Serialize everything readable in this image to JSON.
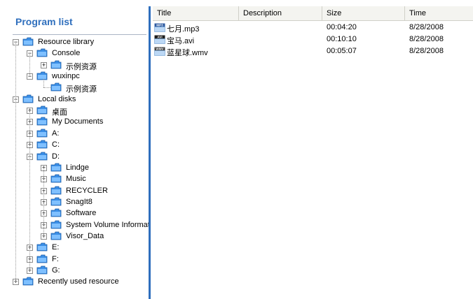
{
  "program_list": {
    "title": "Program list"
  },
  "tree": [
    {
      "id": "n0",
      "label": "Resource library",
      "level": 0,
      "toggle": "minus"
    },
    {
      "id": "n1",
      "label": "Console",
      "level": 1,
      "toggle": "minus"
    },
    {
      "id": "n2",
      "label": "示例资源",
      "level": 2,
      "toggle": "plus"
    },
    {
      "id": "n3",
      "label": "wuxinpc",
      "level": 1,
      "toggle": "minus"
    },
    {
      "id": "n4",
      "label": "示例资源",
      "level": 2,
      "toggle": "none"
    },
    {
      "id": "n5",
      "label": "Local disks",
      "level": 0,
      "toggle": "minus"
    },
    {
      "id": "n6",
      "label": "桌面",
      "level": 1,
      "toggle": "plus"
    },
    {
      "id": "n7",
      "label": "My Documents",
      "level": 1,
      "toggle": "plus"
    },
    {
      "id": "n8",
      "label": "A:",
      "level": 1,
      "toggle": "plus"
    },
    {
      "id": "n9",
      "label": "C:",
      "level": 1,
      "toggle": "plus"
    },
    {
      "id": "n10",
      "label": "D:",
      "level": 1,
      "toggle": "minus"
    },
    {
      "id": "n11",
      "label": "Lindge",
      "level": 2,
      "toggle": "plus"
    },
    {
      "id": "n12",
      "label": "Music",
      "level": 2,
      "toggle": "plus"
    },
    {
      "id": "n13",
      "label": "RECYCLER",
      "level": 2,
      "toggle": "plus"
    },
    {
      "id": "n14",
      "label": "SnagIt8",
      "level": 2,
      "toggle": "plus"
    },
    {
      "id": "n15",
      "label": "Software",
      "level": 2,
      "toggle": "plus"
    },
    {
      "id": "n16",
      "label": "System Volume Informatic",
      "level": 2,
      "toggle": "plus"
    },
    {
      "id": "n17",
      "label": "Visor_Data",
      "level": 2,
      "toggle": "plus"
    },
    {
      "id": "n18",
      "label": "E:",
      "level": 1,
      "toggle": "plus"
    },
    {
      "id": "n19",
      "label": "F:",
      "level": 1,
      "toggle": "plus"
    },
    {
      "id": "n20",
      "label": "G:",
      "level": 1,
      "toggle": "plus"
    },
    {
      "id": "n21",
      "label": "Recently used resource",
      "level": 0,
      "toggle": "plus"
    }
  ],
  "table": {
    "columns": [
      "Title",
      "Description",
      "Size",
      "Time"
    ],
    "rows": [
      {
        "title": "七月.mp3",
        "description": "",
        "size": "00:04:20",
        "time": "8/28/2008",
        "badge": "MP3"
      },
      {
        "title": "宝马.avi",
        "description": "",
        "size": "00:10:10",
        "time": "8/28/2008",
        "badge": "AVI"
      },
      {
        "title": "蓝星球.wmv",
        "description": "",
        "size": "00:05:07",
        "time": "8/28/2008",
        "badge": "WMV"
      }
    ]
  },
  "colors": {
    "accent": "#2f6fbd",
    "folder": "#3a8ee6"
  }
}
